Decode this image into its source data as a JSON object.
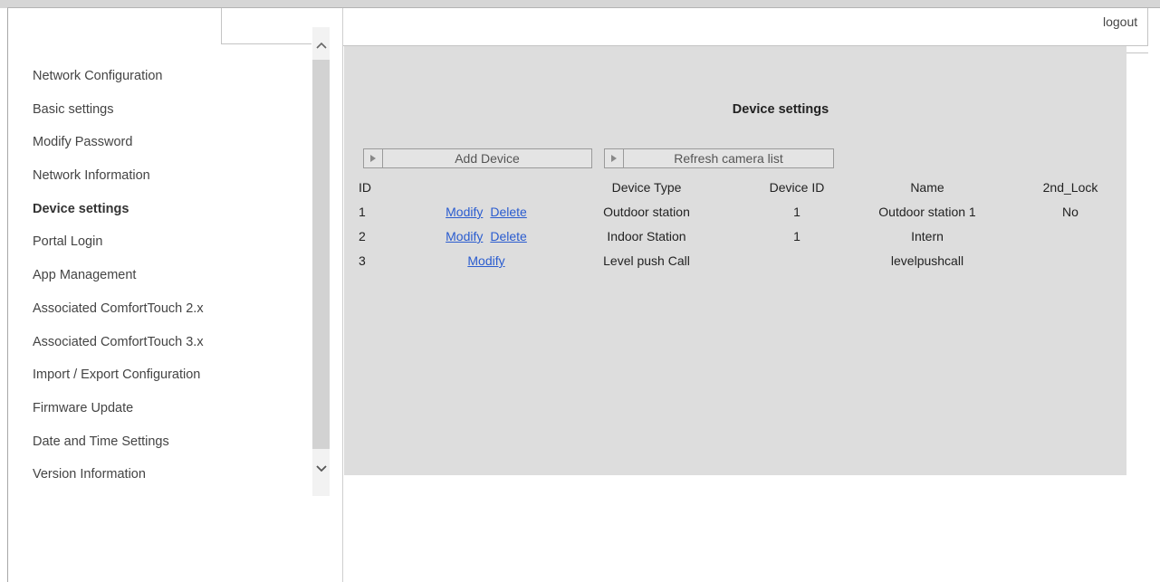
{
  "header": {
    "logout_label": "logout"
  },
  "sidebar": {
    "items": [
      {
        "label": "Network Configuration"
      },
      {
        "label": "Basic settings"
      },
      {
        "label": "Modify Password"
      },
      {
        "label": "Network Information"
      },
      {
        "label": "Device settings",
        "active": true
      },
      {
        "label": "Portal Login"
      },
      {
        "label": "App Management"
      },
      {
        "label": "Associated ComfortTouch 2.x"
      },
      {
        "label": "Associated ComfortTouch 3.x"
      },
      {
        "label": "Import / Export Configuration"
      },
      {
        "label": "Firmware Update"
      },
      {
        "label": "Date and Time Settings"
      },
      {
        "label": "Version Information"
      }
    ]
  },
  "main": {
    "title": "Device settings",
    "add_device_label": "Add Device",
    "refresh_label": "Refresh camera list",
    "table": {
      "headers": {
        "id": "ID",
        "device_type": "Device Type",
        "device_id": "Device ID",
        "name": "Name",
        "second_lock": "2nd_Lock"
      },
      "rows": [
        {
          "id": "1",
          "modify": "Modify",
          "delete": "Delete",
          "device_type": "Outdoor station",
          "device_id": "1",
          "name": "Outdoor station 1",
          "second_lock": "No"
        },
        {
          "id": "2",
          "modify": "Modify",
          "delete": "Delete",
          "device_type": "Indoor Station",
          "device_id": "1",
          "name": "Intern",
          "second_lock": ""
        },
        {
          "id": "3",
          "modify": "Modify",
          "delete": "",
          "device_type": "Level push Call",
          "device_id": "",
          "name": "levelpushcall",
          "second_lock": ""
        }
      ]
    }
  },
  "colors": {
    "panel_bg": "#dddddd",
    "link": "#2a5ccf",
    "scroll_thumb": "#d2d2d2"
  },
  "icons": {
    "scroll_up": "chevron-up-icon",
    "scroll_down": "chevron-down-icon",
    "button_arrow": "play-arrow-icon"
  }
}
